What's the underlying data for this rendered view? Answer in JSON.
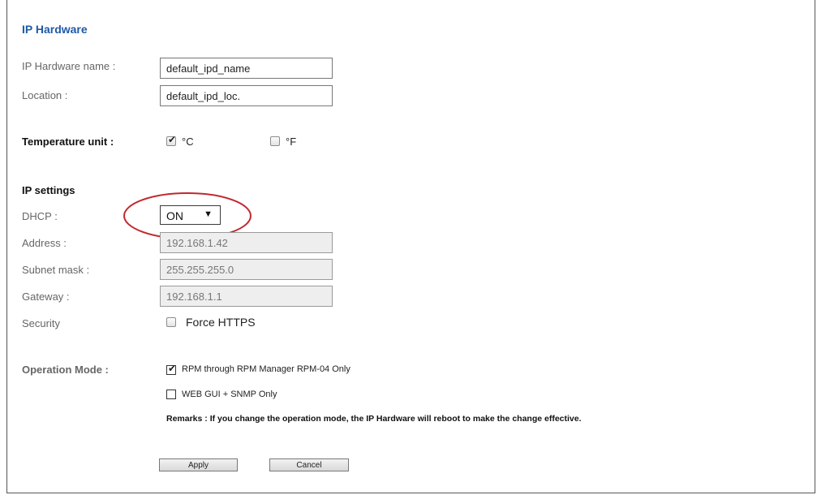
{
  "page_title": "IP Hardware",
  "ip_hardware": {
    "name_label": "IP Hardware name :",
    "name_value": "default_ipd_name",
    "location_label": "Location :",
    "location_value": "default_ipd_loc."
  },
  "temperature": {
    "label": "Temperature unit :",
    "celsius_label": "°C",
    "celsius_checked": true,
    "fahrenheit_label": "°F",
    "fahrenheit_checked": false
  },
  "ip_settings": {
    "heading": "IP settings",
    "dhcp_label": "DHCP :",
    "dhcp_value": "ON",
    "dhcp_arrow": "▼",
    "address_label": "Address :",
    "address_value": "192.168.1.42",
    "subnet_label": "Subnet mask :",
    "subnet_value": "255.255.255.0",
    "gateway_label": "Gateway :",
    "gateway_value": "192.168.1.1",
    "security_label": "Security",
    "force_https_label": "Force HTTPS",
    "force_https_checked": false
  },
  "operation_mode": {
    "label": "Operation Mode :",
    "option1_label": "RPM through RPM Manager RPM-04 Only",
    "option1_checked": true,
    "option2_label": "WEB GUI + SNMP Only",
    "option2_checked": false,
    "remarks": "Remarks : If you change the operation mode, the IP Hardware will reboot to make the change effective."
  },
  "buttons": {
    "apply": "Apply",
    "cancel": "Cancel"
  },
  "colors": {
    "title": "#1f5aa6",
    "highlight_circle": "#c0282d"
  },
  "check_glyph": "✔"
}
